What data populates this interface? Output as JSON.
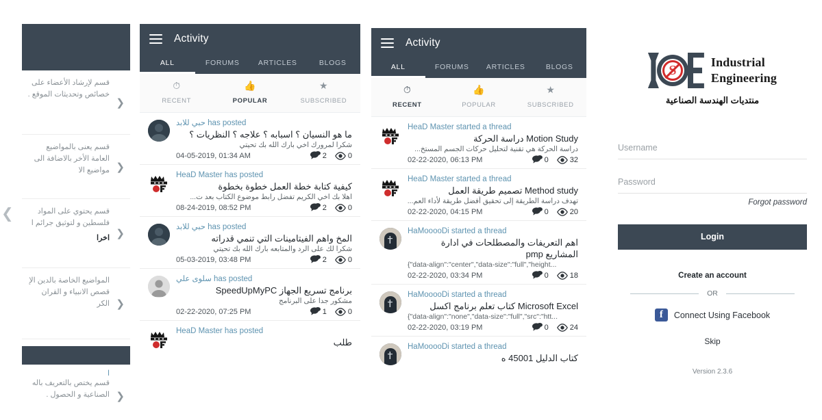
{
  "app": {
    "title": "Activity",
    "menu_icon": "hamburger-icon"
  },
  "tabs": [
    "ALL",
    "FORUMS",
    "ARTICLES",
    "BLOGS"
  ],
  "subtabs": [
    {
      "label": "RECENT",
      "icon": "clock-icon"
    },
    {
      "label": "POPULAR",
      "icon": "thumbs-up-icon"
    },
    {
      "label": "SUBSCRIBED",
      "icon": "star-icon"
    }
  ],
  "colors": {
    "appbar": "#3c4854",
    "link": "#5e93b0",
    "facebook": "#3b5998",
    "logo_red": "#d22b2b"
  },
  "drawer": {
    "categories": [
      {
        "desc": "قسم لإرشاد الأعضاء على خصائص وتحديثات الموقع .",
        "extra": "",
        "chevron": "chevron-right-icon"
      },
      {
        "desc": "قسم يعنى بالمواضيع العامة الأخر بالاضافة الى مواضيع الا",
        "extra": "",
        "chevron": "chevron-right-icon"
      },
      {
        "desc": "قسم يحتوي على المواد فلسطين و لتوثيق جرائم ا",
        "extra": "اخرا",
        "chevron": "chevron-right-icon"
      },
      {
        "desc": "المواضيع الخاصة بالدين الإ قصص الانبياء و القران الكر",
        "extra": "",
        "chevron": "chevron-right-icon"
      },
      {
        "desc": "قسم يختص بالتعريف باله الصناعية و الحصول .",
        "extra": "ا",
        "chevron": "chevron-right-icon"
      }
    ]
  },
  "panel_popular": {
    "selected_tab": "ALL",
    "selected_subtab": "POPULAR",
    "rows": [
      {
        "who": "حبي للابد has posted",
        "avatar": "photo-dark-avatar",
        "title": "ما هو النسيان ؟ اسبابه ؟ علاجه ؟ النظريات ؟",
        "snippet": "شكرا لمرورك اخي  بارك الله بك  تحيتي",
        "date": "04-05-2019, 01:34 AM",
        "comments": "2",
        "views": "0"
      },
      {
        "who": "HeaD Master has posted",
        "avatar": "crown-avatar",
        "title": "كيفية كتابة خطة العمل خطوة بخطوة",
        "snippet": "اهلا بك اخي الكريم   تفضل رابط موضوع الكتاب بعد ت...",
        "date": "08-24-2019, 08:52 PM",
        "comments": "2",
        "views": "0"
      },
      {
        "who": "حبي للابد has posted",
        "avatar": "photo-dark-avatar",
        "title": "المخ واهم الفيتامينات التي تنمي قدراته",
        "snippet": "شكرا لك على الرد والمتابعه  بارك الله بك  تحيتي",
        "date": "05-03-2019, 03:48 PM",
        "comments": "2",
        "views": "0"
      },
      {
        "who": "سلوى علي has posted",
        "avatar": "grey-avatar",
        "title": "برنامج تسريع الجهاز SpeedUpMyPC",
        "snippet": "مشكور جدا على البرنامج",
        "date": "02-22-2020, 07:25 PM",
        "comments": "1",
        "views": "0"
      },
      {
        "who": "HeaD Master has posted",
        "avatar": "crown-avatar",
        "title": "طلب",
        "snippet": "",
        "date": "",
        "comments": "",
        "views": ""
      }
    ]
  },
  "panel_recent": {
    "selected_tab": "ALL",
    "selected_subtab": "RECENT",
    "rows": [
      {
        "who": "HeaD Master started a thread",
        "avatar": "crown-avatar",
        "title": "Motion Study دراسة الحركة",
        "snippet": "دراسة الحركة هي تقنية لتحليل حركات الجسم المستخ...",
        "date": "02-22-2020, 06:13 PM",
        "comments": "0",
        "views": "32"
      },
      {
        "who": "HeaD Master started a thread",
        "avatar": "crown-avatar",
        "title": "Method study تصميم طريقة العمل",
        "snippet": "تهدف دراسة الطريقة إلى تحقيق أفضل طريقة لأداء العم...",
        "date": "02-22-2020, 04:15 PM",
        "comments": "0",
        "views": "20"
      },
      {
        "who": "HaMooooDi started a thread",
        "avatar": "photo-dark-avatar",
        "title": "اهم التعريفات والمصطلحات في ادارة المشاريع pmp",
        "snippet": "{\"data-align\":\"center\",\"data-size\":\"full\",\"height...",
        "date": "02-22-2020, 03:34 PM",
        "comments": "0",
        "views": "18"
      },
      {
        "who": "HaMooooDi started a thread",
        "avatar": "photo-dark-avatar",
        "title": "Microsoft Excel كتاب تعلم برنامج اكسل",
        "snippet": "{\"data-align\":\"none\",\"data-size\":\"full\",\"src\":\"htt...",
        "date": "02-22-2020, 03:19 PM",
        "comments": "0",
        "views": "24"
      },
      {
        "who": "HaMooooDi started a thread",
        "avatar": "photo-dark-avatar",
        "title": "كتاب الدليل 45001 ه",
        "snippet": "",
        "date": "",
        "comments": "",
        "views": ""
      }
    ]
  },
  "login": {
    "logo": {
      "letter_i": "I",
      "letter_o": "o",
      "letter_e": "E",
      "mark_s": "S",
      "line1": "Industrial",
      "line2": "Engineering",
      "arabic": "منتديات  الهندسة الصناعية"
    },
    "username_placeholder": "Username",
    "username_value": "",
    "password_placeholder": "Password",
    "password_value": "",
    "forgot_label": "Forgot password",
    "login_label": "Login",
    "create_account_label": "Create an account",
    "or_label": "OR",
    "facebook_label": "Connect Using Facebook",
    "facebook_icon": "facebook-icon",
    "skip_label": "Skip",
    "version": "Version 2.3.6"
  }
}
